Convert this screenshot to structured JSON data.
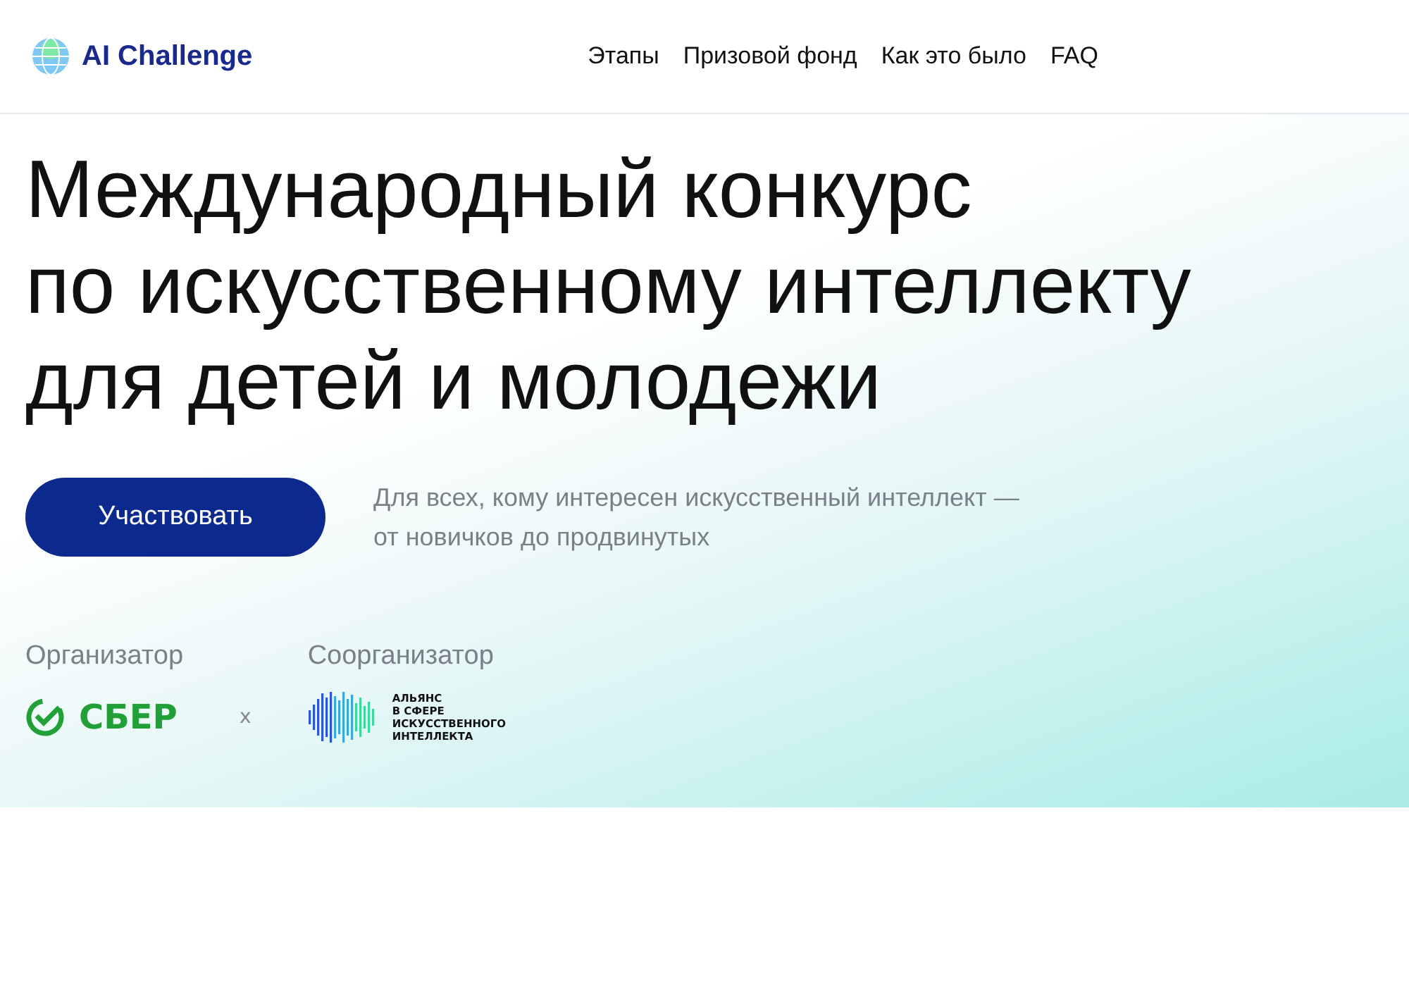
{
  "header": {
    "logo": "AI Challenge",
    "nav": [
      "Этапы",
      "Призовой фонд",
      "Как это было",
      "FAQ"
    ]
  },
  "hero": {
    "title_lines": [
      "Международный конкурс",
      "по искусственному интеллекту",
      "для детей и молодежи"
    ],
    "button": "Участвовать",
    "subtitle_lines": [
      "Для всех, кому интересен искусственный интеллект —",
      "от новичков до продвинутых"
    ],
    "organizers": [
      {
        "label": "Организатор",
        "kind": "sber",
        "logo_text": [
          "СБЕР"
        ]
      },
      {
        "label": "Соорганизатор",
        "kind": "alliance",
        "logo_text": [
          "АЛЬЯНС",
          "В СФЕРЕ",
          "ИСКУССТВЕННОГО",
          "ИНТЕЛЛЕКТА"
        ]
      }
    ],
    "separator": "x"
  }
}
